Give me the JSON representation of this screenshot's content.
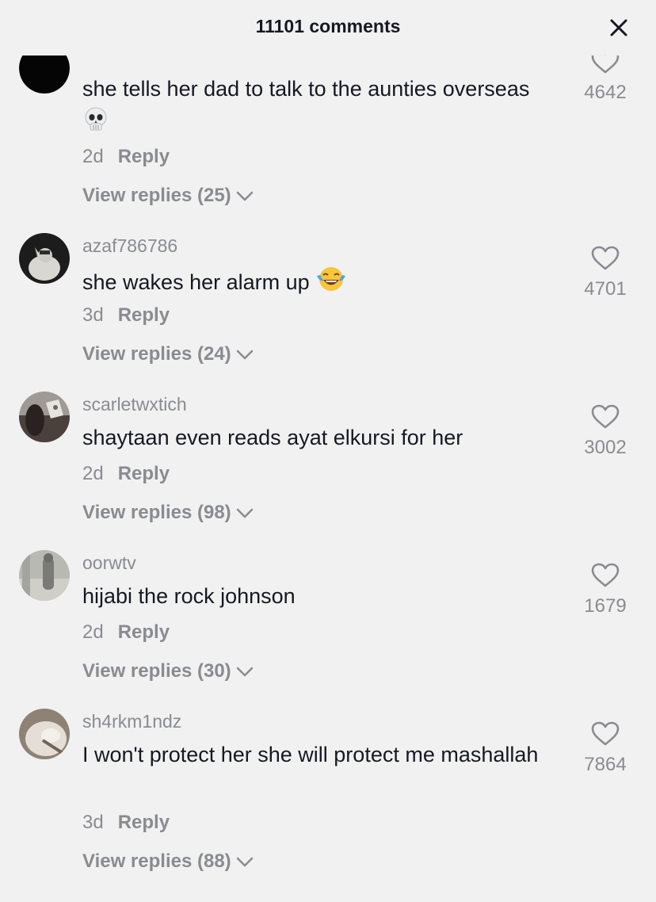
{
  "header": {
    "title": "11101 comments",
    "close_icon": "close-icon"
  },
  "comments": [
    {
      "username": "",
      "text": "she tells her dad to talk to the aunties overseas",
      "emoji": "skull",
      "age": "2d",
      "reply_label": "Reply",
      "replies_label": "View replies (25)",
      "likes": "4642"
    },
    {
      "username": "azaf786786",
      "text": "she wakes her alarm up",
      "emoji": "tears-of-joy",
      "age": "3d",
      "reply_label": "Reply",
      "replies_label": "View replies (24)",
      "likes": "4701"
    },
    {
      "username": "scarletwxtich",
      "text": "shaytaan even reads ayat elkursi for her",
      "age": "2d",
      "reply_label": "Reply",
      "replies_label": "View replies (98)",
      "likes": "3002"
    },
    {
      "username": "oorwtv",
      "text": "hijabi the rock johnson",
      "age": "2d",
      "reply_label": "Reply",
      "replies_label": "View replies (30)",
      "likes": "1679"
    },
    {
      "username": "sh4rkm1ndz",
      "text": "I won't protect her she will protect me mashallah",
      "age": "3d",
      "reply_label": "Reply",
      "replies_label": "View replies (88)",
      "likes": "7864"
    }
  ],
  "colors": {
    "background": "#f1f1f2",
    "primary_text": "#161823",
    "secondary_text": "#8a8b91"
  }
}
